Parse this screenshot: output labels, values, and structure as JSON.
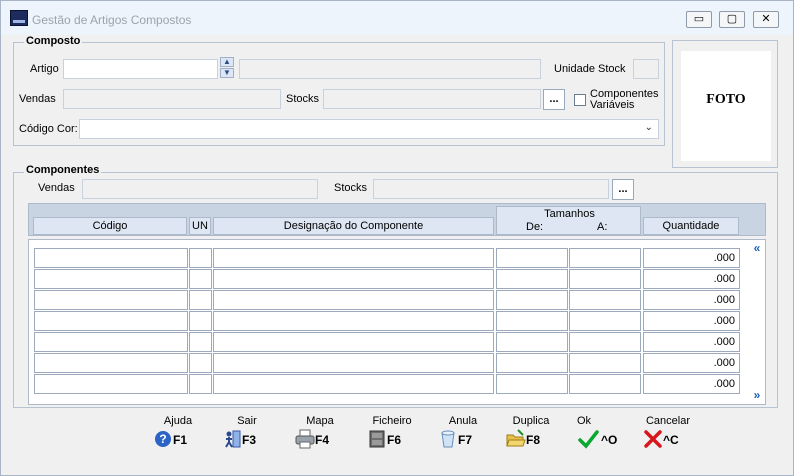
{
  "window": {
    "title": "Gestão de Artigos Compostos",
    "controls": [
      "▭",
      "▢",
      "✕"
    ]
  },
  "composto": {
    "title": "Composto",
    "artigo_label": "Artigo",
    "unidade_stock_label": "Unidade Stock",
    "vendas_label": "Vendas",
    "stocks_label": "Stocks",
    "componentes_variaveis_label": "Componentes Variáveis",
    "codigo_cor_label": "Código Cor:",
    "ellipsis": "..."
  },
  "foto": {
    "label": "FOTO"
  },
  "componentes": {
    "title": "Componentes",
    "vendas_label": "Vendas",
    "stocks_label": "Stocks",
    "ellipsis": "...",
    "columns": {
      "codigo": "Código",
      "un": "UN",
      "designacao": "Designação do Componente",
      "tamanhos": "Tamanhos",
      "de": "De:",
      "a": "A:",
      "quantidade": "Quantidade"
    },
    "rows": [
      {
        "quantidade": ".000"
      },
      {
        "quantidade": ".000"
      },
      {
        "quantidade": ".000"
      },
      {
        "quantidade": ".000"
      },
      {
        "quantidade": ".000"
      },
      {
        "quantidade": ".000"
      },
      {
        "quantidade": ".000"
      }
    ]
  },
  "toolbar": [
    {
      "label": "Ajuda",
      "key": "F1",
      "icon": "help-icon"
    },
    {
      "label": "Sair",
      "key": "F3",
      "icon": "exit-icon"
    },
    {
      "label": "Mapa",
      "key": "F4",
      "icon": "printer-icon"
    },
    {
      "label": "Ficheiro",
      "key": "F6",
      "icon": "file-cabinet-icon"
    },
    {
      "label": "Anula",
      "key": "F7",
      "icon": "cancel-record-icon"
    },
    {
      "label": "Duplica",
      "key": "F8",
      "icon": "folder-open-icon"
    },
    {
      "label": "Ok",
      "key": "^O",
      "icon": "checkmark-icon"
    },
    {
      "label": "Cancelar",
      "key": "^C",
      "icon": "red-x-icon"
    }
  ],
  "colors": {
    "accent": "#1b5fb7",
    "ok_green": "#0aa830",
    "cancel_red": "#d8171c"
  }
}
